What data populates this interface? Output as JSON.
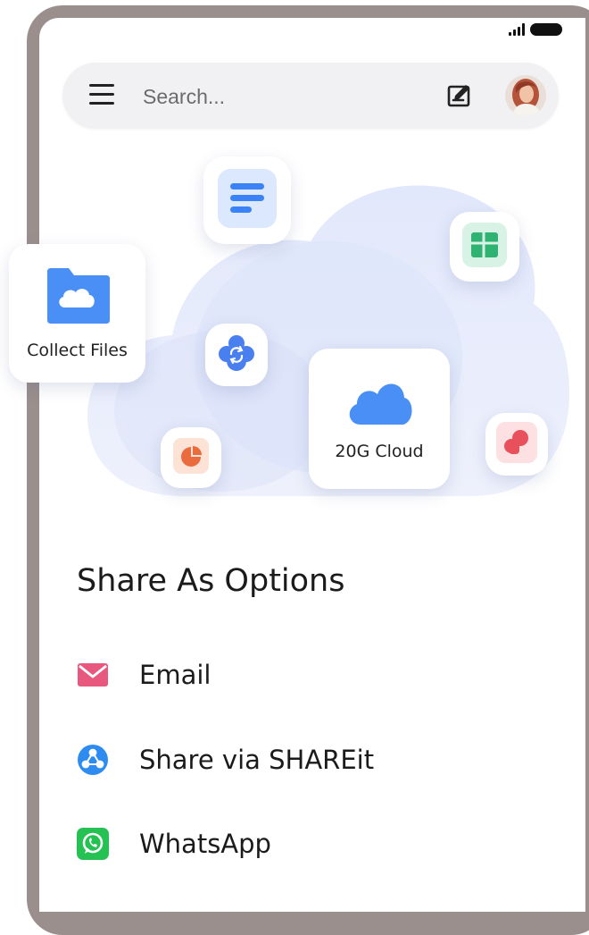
{
  "search": {
    "placeholder": "Search..."
  },
  "icons": {
    "menu": "menu-icon",
    "compose": "compose-icon",
    "avatar": "user-avatar",
    "docs": "docs-icon",
    "sheets": "sheets-icon",
    "folder": "cloud-folder-icon",
    "sync": "cloud-sync-icon",
    "cloud": "cloud-icon",
    "slides": "slides-pie-icon",
    "pdf": "pdf-icon"
  },
  "cards": {
    "collect_files": "Collect Files",
    "cloud": "20G Cloud"
  },
  "share": {
    "title": "Share As Options",
    "options": [
      {
        "label": "Email",
        "icon": "email-icon",
        "color": "#e8577d"
      },
      {
        "label": "Share via SHAREit",
        "icon": "shareit-icon",
        "color": "#2e8cf0"
      },
      {
        "label": "WhatsApp",
        "icon": "whatsapp-icon",
        "color": "#25c253"
      }
    ]
  },
  "colors": {
    "accent_blue": "#4a8ff5",
    "cloud_bg": "#e3e9fb",
    "docs_blue": "#3b82f6",
    "sheets_green": "#2fb272",
    "pie_orange": "#ea6b3d",
    "pdf_red": "#e8505b"
  }
}
